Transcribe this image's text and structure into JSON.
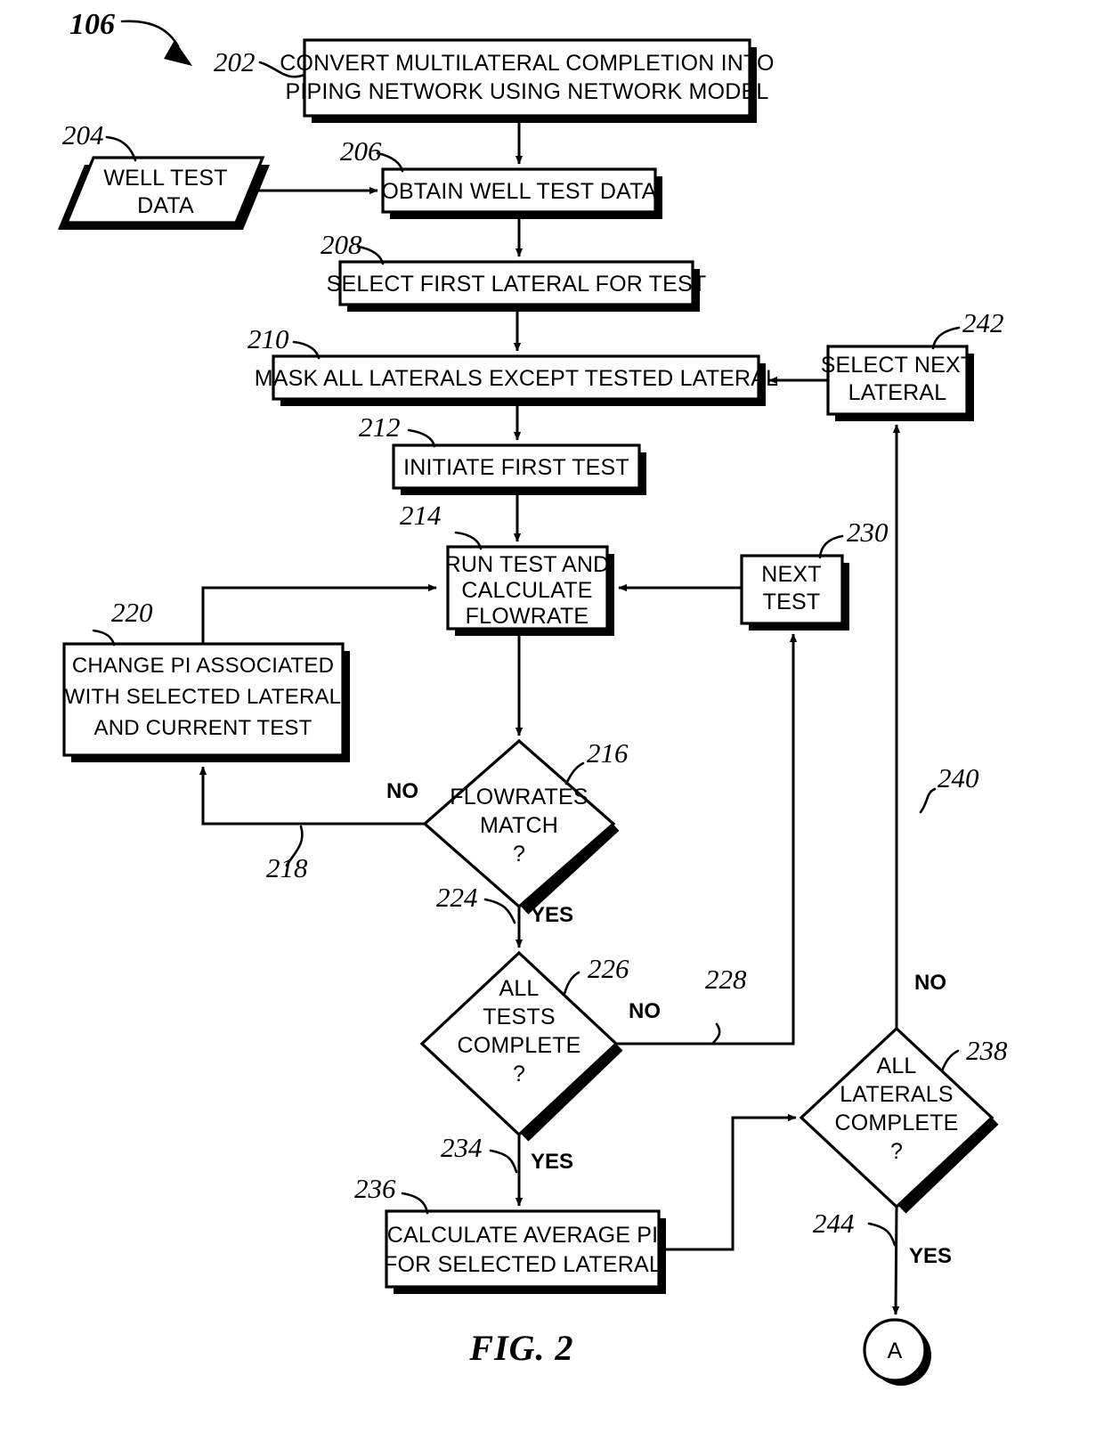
{
  "figure": {
    "caption": "FIG. 2",
    "main_ref": "106"
  },
  "nodes": {
    "n202": {
      "ref": "202",
      "text_lines": [
        "CONVERT MULTILATERAL COMPLETION INTO",
        "PIPING NETWORK USING NETWORK MODEL"
      ]
    },
    "n204": {
      "ref": "204",
      "text_lines": [
        "WELL TEST",
        "DATA"
      ]
    },
    "n206": {
      "ref": "206",
      "text_lines": [
        "OBTAIN WELL TEST DATA"
      ]
    },
    "n208": {
      "ref": "208",
      "text_lines": [
        "SELECT FIRST LATERAL FOR TEST"
      ]
    },
    "n210": {
      "ref": "210",
      "text_lines": [
        "MASK ALL LATERALS EXCEPT TESTED LATERAL"
      ]
    },
    "n212": {
      "ref": "212",
      "text_lines": [
        "INITIATE FIRST TEST"
      ]
    },
    "n214": {
      "ref": "214",
      "text_lines": [
        "RUN TEST AND",
        "CALCULATE",
        "FLOWRATE"
      ]
    },
    "n216": {
      "ref": "216",
      "text_lines": [
        "FLOWRATES",
        "MATCH",
        "?"
      ]
    },
    "n220": {
      "ref": "220",
      "text_lines": [
        "CHANGE PI ASSOCIATED",
        "WITH SELECTED LATERAL",
        "AND CURRENT TEST"
      ]
    },
    "n226": {
      "ref": "226",
      "text_lines": [
        "ALL",
        "TESTS",
        "COMPLETE",
        "?"
      ]
    },
    "n230": {
      "ref": "230",
      "text_lines": [
        "NEXT",
        "TEST"
      ]
    },
    "n236": {
      "ref": "236",
      "text_lines": [
        "CALCULATE AVERAGE PI",
        "FOR SELECTED LATERAL"
      ]
    },
    "n238": {
      "ref": "238",
      "text_lines": [
        "ALL",
        "LATERALS",
        "COMPLETE",
        "?"
      ]
    },
    "n242": {
      "ref": "242",
      "text_lines": [
        "SELECT NEXT",
        "LATERAL"
      ]
    },
    "nA": {
      "label": "A"
    }
  },
  "edge_refs": {
    "e218": "218",
    "e224": "224",
    "e228": "228",
    "e234": "234",
    "e240": "240",
    "e244": "244"
  },
  "branch_labels": {
    "flowrates_no": "NO",
    "flowrates_yes": "YES",
    "all_tests_no": "NO",
    "all_tests_yes": "YES",
    "all_laterals_no": "NO",
    "all_laterals_yes": "YES"
  },
  "colors": {
    "ink": "#000000",
    "paper": "#ffffff"
  }
}
